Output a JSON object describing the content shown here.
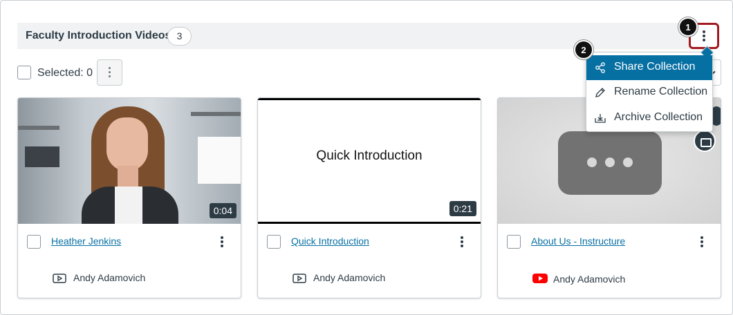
{
  "collection": {
    "title": "Faculty Introduction Videos",
    "count": "3"
  },
  "toolbar": {
    "selected_label": "Selected: 0"
  },
  "callouts": [
    "1",
    "2"
  ],
  "menu": {
    "items": [
      {
        "label": "Share Collection",
        "icon": "share-icon",
        "active": true
      },
      {
        "label": "Rename Collection",
        "icon": "pencil-icon",
        "active": false
      },
      {
        "label": "Archive Collection",
        "icon": "archive-icon",
        "active": false
      }
    ]
  },
  "cards": [
    {
      "title": "Heather Jenkins",
      "duration": "0:04",
      "owner": "Andy Adamovich",
      "owner_icon": "video-icon"
    },
    {
      "title": "Quick Introduction",
      "duration": "0:21",
      "slide_text": "Quick Introduction",
      "owner": "Andy Adamovich",
      "owner_icon": "video-icon"
    },
    {
      "title": "About Us - Instructure",
      "owner": "Andy Adamovich",
      "owner_icon": "youtube-icon",
      "has_captions": true
    }
  ],
  "colors": {
    "link": "#0770a3",
    "highlight_border": "#a11a1f",
    "menu_active": "#0770a3",
    "youtube_red": "#ff0000"
  }
}
